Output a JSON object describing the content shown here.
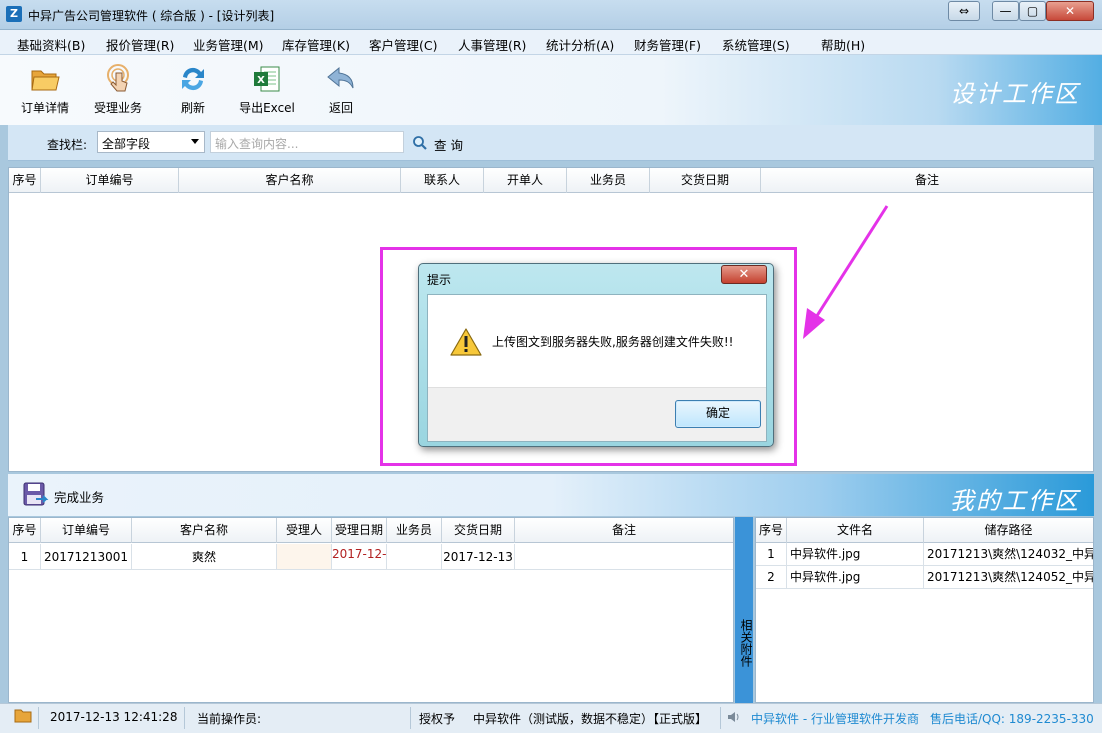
{
  "window": {
    "title": "中异广告公司管理软件 ( 综合版 ) - [设计列表]",
    "app_icon": "Z",
    "controls": {
      "switch": "⇔",
      "minimize": "—",
      "maximize": "▢",
      "close": "✕"
    }
  },
  "menu": [
    "基础资料(B)",
    "报价管理(R)",
    "业务管理(M)",
    "库存管理(K)",
    "客户管理(C)",
    "人事管理(R)",
    "统计分析(A)",
    "财务管理(F)",
    "系统管理(S)",
    "帮助(H)"
  ],
  "toolbar": {
    "items": [
      {
        "label": "订单详情",
        "icon": "folder-open-icon"
      },
      {
        "label": "受理业务",
        "icon": "touch-hand-icon"
      },
      {
        "label": "刷新",
        "icon": "refresh-icon"
      },
      {
        "label": "导出Excel",
        "icon": "excel-icon"
      },
      {
        "label": "返回",
        "icon": "back-arrow-icon"
      }
    ],
    "area_title": "设计工作区"
  },
  "search": {
    "label": "查找栏:",
    "field_value": "全部字段",
    "placeholder": "输入查询内容...",
    "button": "查 询"
  },
  "upper_table": {
    "columns": [
      "序号",
      "订单编号",
      "客户名称",
      "联系人",
      "开单人",
      "业务员",
      "交货日期",
      "备注"
    ],
    "rows": []
  },
  "dialog": {
    "title": "提示",
    "message": "上传图文到服务器失败,服务器创建文件失败!!",
    "ok_label": "确定",
    "close_label": "✕"
  },
  "my_workarea": {
    "action_label": "完成业务",
    "title": "我的工作区"
  },
  "lower_table": {
    "columns": [
      "序号",
      "订单编号",
      "客户名称",
      "受理人",
      "受理日期",
      "业务员",
      "交货日期",
      "备注"
    ],
    "rows": [
      [
        "1",
        "20171213001",
        "爽然",
        "",
        "2017-12-",
        "",
        "2017-12-13",
        ""
      ]
    ]
  },
  "attachments": {
    "tab_label": "相关附件",
    "columns": [
      "序号",
      "文件名",
      "储存路径"
    ],
    "rows": [
      [
        "1",
        "中异软件.jpg",
        "20171213\\爽然\\124032_中异"
      ],
      [
        "2",
        "中异软件.jpg",
        "20171213\\爽然\\124052_中异"
      ]
    ]
  },
  "status": {
    "datetime": "2017-12-13 12:41:28",
    "operator_label": "当前操作员:",
    "authorized_label": "授权予",
    "license": "中异软件（测试版，数据不稳定）【正式版】",
    "company": "中异软件 - 行业管理软件开发商",
    "hotline": "售后电话/QQ: 189-2235-330"
  },
  "colors": {
    "highlight": "#e432e8",
    "accent_blue": "#2a9ad9",
    "date_red": "#b22222"
  }
}
